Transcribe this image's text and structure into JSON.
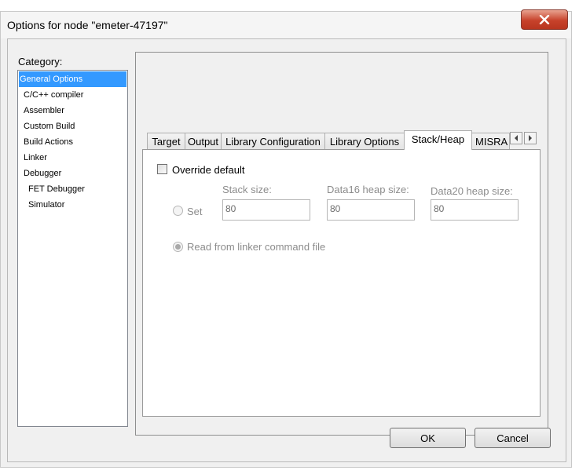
{
  "window": {
    "title": "Options for node \"emeter-47197\""
  },
  "category": {
    "label": "Category:",
    "items": [
      {
        "label": "General Options"
      },
      {
        "label": "C/C++ compiler"
      },
      {
        "label": "Assembler"
      },
      {
        "label": "Custom Build"
      },
      {
        "label": "Build Actions"
      },
      {
        "label": "Linker"
      },
      {
        "label": "Debugger"
      },
      {
        "label": "FET Debugger"
      },
      {
        "label": "Simulator"
      }
    ],
    "selected": "General Options"
  },
  "tabs": [
    {
      "label": "Target"
    },
    {
      "label": "Output"
    },
    {
      "label": "Library Configuration"
    },
    {
      "label": "Library Options"
    },
    {
      "label": "Stack/Heap"
    },
    {
      "label": "MISRA"
    }
  ],
  "active_tab": "Stack/Heap",
  "stack_heap": {
    "override_label": "Override default",
    "override_checked": false,
    "set_label": "Set",
    "read_label": "Read from linker command file",
    "stack_size_label": "Stack size:",
    "stack_size_value": "80",
    "data16_label": "Data16 heap size:",
    "data16_value": "80",
    "data20_label": "Data20 heap size:",
    "data20_value": "80"
  },
  "buttons": {
    "ok": "OK",
    "cancel": "Cancel"
  },
  "colors": {
    "selection": "#3399ff",
    "close_button": "#c7422b"
  }
}
